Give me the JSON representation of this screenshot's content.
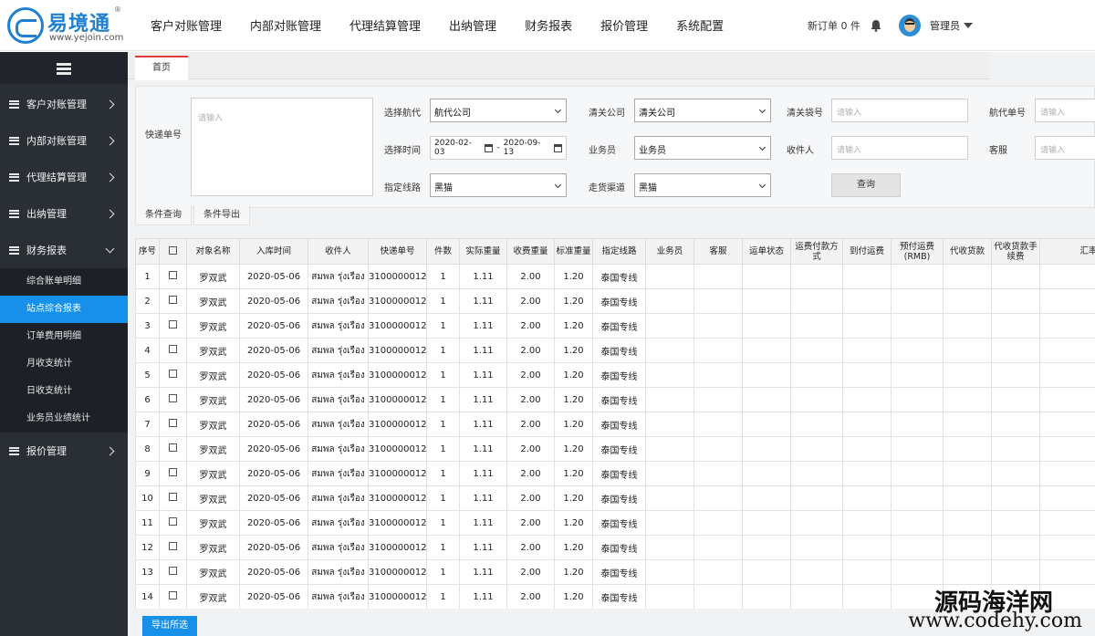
{
  "brand": {
    "name": "易境通",
    "reg": "®",
    "url": "www.yejoin.com"
  },
  "topnav": [
    "客户对账管理",
    "内部对账管理",
    "代理结算管理",
    "出纳管理",
    "财务报表",
    "报价管理",
    "系统配置"
  ],
  "header": {
    "new_orders": "新订单 0 件",
    "user": "管理员"
  },
  "sidebar": {
    "groups": [
      "客户对账管理",
      "内部对账管理",
      "代理结算管理",
      "出纳管理",
      "财务报表",
      "报价管理"
    ],
    "sub_items": [
      "综合账单明细",
      "站点综合报表",
      "订单费用明细",
      "月收支统计",
      "日收支统计",
      "业务员业绩统计"
    ],
    "active_sub": "站点综合报表"
  },
  "tabs": {
    "home": "首页"
  },
  "filters": {
    "tracking_label": "快递单号",
    "tracking_placeholder": "请输入",
    "airline_label": "选择航代",
    "airline_value": "航代公司",
    "clearance_label": "清关公司",
    "clearance_value": "清关公司",
    "bag_label": "清关袋号",
    "bag_placeholder": "请输入",
    "agent_no_label": "航代单号",
    "agent_no_placeholder": "请输入",
    "time_label": "选择时间",
    "date_from": "2020-02-03",
    "date_sep": "-",
    "date_to": "2020-09-13",
    "salesman_label": "业务员",
    "salesman_value": "业务员",
    "receiver_label": "收件人",
    "receiver_placeholder": "请输入",
    "service_label": "客服",
    "service_placeholder": "请输入",
    "route_label": "指定线路",
    "route_value": "黑猫",
    "channel_label": "走货渠道",
    "channel_value": "黑猫",
    "query_button": "查询"
  },
  "subtabs": [
    "条件查询",
    "条件导出"
  ],
  "table": {
    "columns": [
      "序号",
      "☐",
      "对象名称",
      "入库时间",
      "收件人",
      "快递单号",
      "件数",
      "实际重量",
      "收费重量",
      "标准重量",
      "指定线路",
      "业务员",
      "客服",
      "运单状态",
      "运费付款方式",
      "到付运费",
      "预付运费(RMB)",
      "代收货款",
      "代收货款手续费",
      "汇率"
    ],
    "rows": [
      [
        "1",
        "",
        "罗双武",
        "2020-05-06",
        "สมพล รุ่งเรือง",
        "3100000012",
        "1",
        "1.11",
        "2.00",
        "1.20",
        "泰国专线"
      ],
      [
        "2",
        "",
        "罗双武",
        "2020-05-06",
        "สมพล รุ่งเรือง",
        "3100000012",
        "1",
        "1.11",
        "2.00",
        "1.20",
        "泰国专线"
      ],
      [
        "3",
        "",
        "罗双武",
        "2020-05-06",
        "สมพล รุ่งเรือง",
        "3100000012",
        "1",
        "1.11",
        "2.00",
        "1.20",
        "泰国专线"
      ],
      [
        "4",
        "",
        "罗双武",
        "2020-05-06",
        "สมพล รุ่งเรือง",
        "3100000012",
        "1",
        "1.11",
        "2.00",
        "1.20",
        "泰国专线"
      ],
      [
        "5",
        "",
        "罗双武",
        "2020-05-06",
        "สมพล รุ่งเรือง",
        "3100000012",
        "1",
        "1.11",
        "2.00",
        "1.20",
        "泰国专线"
      ],
      [
        "6",
        "",
        "罗双武",
        "2020-05-06",
        "สมพล รุ่งเรือง",
        "3100000012",
        "1",
        "1.11",
        "2.00",
        "1.20",
        "泰国专线"
      ],
      [
        "7",
        "",
        "罗双武",
        "2020-05-06",
        "สมพล รุ่งเรือง",
        "3100000012",
        "1",
        "1.11",
        "2.00",
        "1.20",
        "泰国专线"
      ],
      [
        "8",
        "",
        "罗双武",
        "2020-05-06",
        "สมพล รุ่งเรือง",
        "3100000012",
        "1",
        "1.11",
        "2.00",
        "1.20",
        "泰国专线"
      ],
      [
        "9",
        "",
        "罗双武",
        "2020-05-06",
        "สมพล รุ่งเรือง",
        "3100000012",
        "1",
        "1.11",
        "2.00",
        "1.20",
        "泰国专线"
      ],
      [
        "10",
        "",
        "罗双武",
        "2020-05-06",
        "สมพล รุ่งเรือง",
        "3100000012",
        "1",
        "1.11",
        "2.00",
        "1.20",
        "泰国专线"
      ],
      [
        "11",
        "",
        "罗双武",
        "2020-05-06",
        "สมพล รุ่งเรือง",
        "3100000012",
        "1",
        "1.11",
        "2.00",
        "1.20",
        "泰国专线"
      ],
      [
        "12",
        "",
        "罗双武",
        "2020-05-06",
        "สมพล รุ่งเรือง",
        "3100000012",
        "1",
        "1.11",
        "2.00",
        "1.20",
        "泰国专线"
      ],
      [
        "13",
        "",
        "罗双武",
        "2020-05-06",
        "สมพล รุ่งเรือง",
        "3100000012",
        "1",
        "1.11",
        "2.00",
        "1.20",
        "泰国专线"
      ],
      [
        "14",
        "",
        "罗双武",
        "2020-05-06",
        "สมพล รุ่งเรือง",
        "3100000012",
        "1",
        "1.11",
        "2.00",
        "1.20",
        "泰国专线"
      ]
    ]
  },
  "export_button": "导出所选",
  "watermark": {
    "cn": "源码海洋网",
    "en": "www.codehy.com"
  },
  "colors": {
    "brand": "#1f7fd1",
    "accent": "#1690e8",
    "sidebar_bg": "#2a2f36",
    "tab_accent": "#e03b3b"
  },
  "icons": {
    "menu": "hamburger-icon",
    "bell": "bell-icon",
    "calendar": "calendar-icon",
    "caret": "caret-down-icon"
  }
}
